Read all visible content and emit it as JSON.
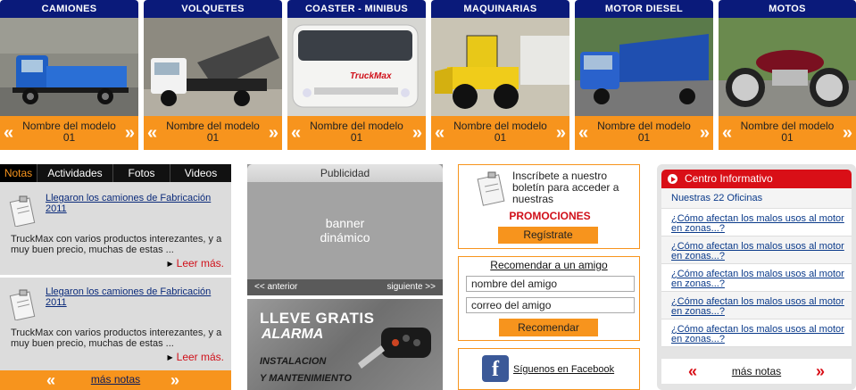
{
  "products": [
    {
      "title": "CAMIONES",
      "model": "Nombre del modelo 01"
    },
    {
      "title": "VOLQUETES",
      "model": "Nombre del modelo 01"
    },
    {
      "title": "COASTER - MINIBUS",
      "model": "Nombre del modelo 01"
    },
    {
      "title": "MAQUINARIAS",
      "model": "Nombre del modelo 01"
    },
    {
      "title": "MOTOR DIESEL",
      "model": "Nombre del modelo 01"
    },
    {
      "title": "MOTOS",
      "model": "Nombre del modelo 01"
    }
  ],
  "product_arrows": {
    "prev": "«",
    "next": "»"
  },
  "coaster_logo": "TruckMax",
  "notas": {
    "tabs": [
      "Notas",
      "Actividades",
      "Fotos",
      "Videos"
    ],
    "items": [
      {
        "title": "Llegaron los camiones de Fabricación 2011",
        "body": "TruckMax con varios productos interezantes, y a muy buen precio, muchas de estas ...",
        "more": "Leer más."
      },
      {
        "title": "Llegaron los camiones de Fabricación 2011",
        "body": "TruckMax con varios productos interezantes, y a muy buen precio, muchas de estas ...",
        "more": "Leer más."
      }
    ],
    "mas_notas": "más notas"
  },
  "publicidad": {
    "title": "Publicidad",
    "banner_line1": "banner",
    "banner_line2": "dinámico",
    "prev": "<< anterior",
    "next": "siguiente >>"
  },
  "alarma": {
    "line1": "LLEVE GRATIS",
    "line2": "ALARMA",
    "line3": "INSTALACION",
    "line4": "Y MANTENIMIENTO"
  },
  "boletin": {
    "text": "Inscríbete a nuestro boletín para acceder a nuestras",
    "promo": "PROMOCIONES",
    "button": "Regístrate"
  },
  "recomendar": {
    "title": "Recomendar a un amigo",
    "name_value": "nombre del amigo",
    "email_value": "correo del amigo",
    "button": "Recomendar"
  },
  "facebook": {
    "icon": "f",
    "text": "Síguenos en Facebook"
  },
  "centro": {
    "title": "Centro Informativo",
    "oficinas": "Nuestras 22 Oficinas",
    "items": [
      "¿Cómo afectan los malos usos al motor en zonas...?",
      "¿Cómo afectan los malos usos al motor en zonas...?",
      "¿Cómo afectan los malos usos al motor en zonas...?",
      "¿Cómo afectan los malos usos al motor en zonas...?",
      "¿Cómo afectan los malos usos al motor en zonas...?"
    ],
    "mas_notas": "más notas"
  },
  "colors": {
    "navy": "#0a1a7a",
    "orange": "#f7941d",
    "red": "#d90f17"
  }
}
